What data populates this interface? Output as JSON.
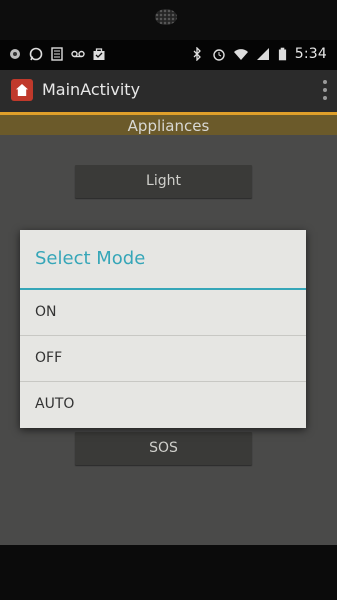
{
  "status_bar": {
    "time": "5:34"
  },
  "action_bar": {
    "title": "MainActivity"
  },
  "content": {
    "header": "Appliances",
    "light_button": "Light",
    "sos_button": "SOS"
  },
  "dialog": {
    "title": "Select Mode",
    "options": [
      "ON",
      "OFF",
      "AUTO"
    ]
  },
  "colors": {
    "accent": "#36a6b8",
    "action_underline": "#e0a02a"
  }
}
